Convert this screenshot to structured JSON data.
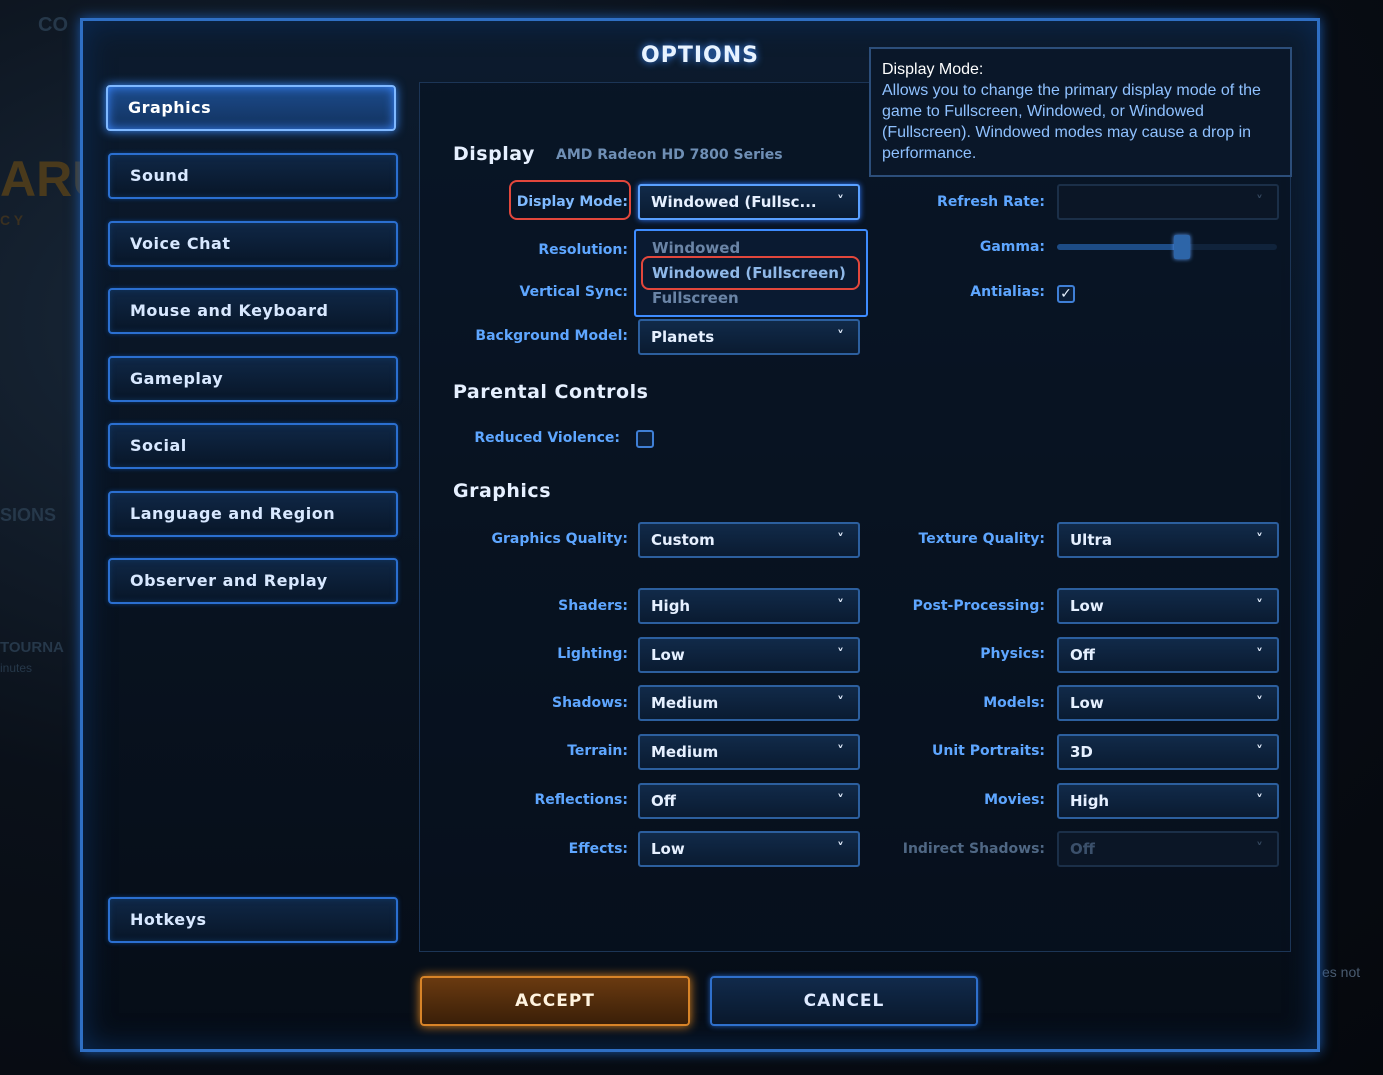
{
  "window": {
    "title": "OPTIONS"
  },
  "nav": [
    {
      "key": "graphics",
      "label": "Graphics",
      "active": true
    },
    {
      "key": "sound",
      "label": "Sound"
    },
    {
      "key": "voice-chat",
      "label": "Voice Chat"
    },
    {
      "key": "mouse-keyboard",
      "label": "Mouse and Keyboard"
    },
    {
      "key": "gameplay",
      "label": "Gameplay"
    },
    {
      "key": "social",
      "label": "Social"
    },
    {
      "key": "language-region",
      "label": "Language and Region"
    },
    {
      "key": "observer-replay",
      "label": "Observer and Replay"
    },
    {
      "key": "hotkeys",
      "label": "Hotkeys"
    }
  ],
  "display": {
    "title": "Display",
    "gpu": "AMD Radeon HD 7800 Series",
    "display_mode_label": "Display Mode:",
    "display_mode_value": "Windowed (Fullsc...",
    "resolution_label": "Resolution:",
    "vsync_label": "Vertical Sync:",
    "background_model_label": "Background Model:",
    "background_model_value": "Planets",
    "refresh_rate_label": "Refresh Rate:",
    "refresh_rate_value": "",
    "gamma_label": "Gamma:",
    "gamma_level": 0.57,
    "antialias_label": "Antialias:",
    "antialias_checked": true,
    "dropdown_options": [
      "Windowed",
      "Windowed (Fullscreen)",
      "Fullscreen"
    ],
    "dropdown_selected": "Windowed (Fullscreen)"
  },
  "parental": {
    "title": "Parental Controls",
    "reduced_violence_label": "Reduced Violence:",
    "reduced_violence_checked": false
  },
  "graphics": {
    "title": "Graphics",
    "quality_label": "Graphics Quality:",
    "quality_value": "Custom",
    "texture_label": "Texture Quality:",
    "texture_value": "Ultra",
    "left": [
      {
        "key": "shaders",
        "label": "Shaders:",
        "value": "High"
      },
      {
        "key": "lighting",
        "label": "Lighting:",
        "value": "Low"
      },
      {
        "key": "shadows",
        "label": "Shadows:",
        "value": "Medium"
      },
      {
        "key": "terrain",
        "label": "Terrain:",
        "value": "Medium"
      },
      {
        "key": "reflections",
        "label": "Reflections:",
        "value": "Off"
      },
      {
        "key": "effects",
        "label": "Effects:",
        "value": "Low"
      }
    ],
    "right": [
      {
        "key": "post-processing",
        "label": "Post-Processing:",
        "value": "Low"
      },
      {
        "key": "physics",
        "label": "Physics:",
        "value": "Off"
      },
      {
        "key": "models",
        "label": "Models:",
        "value": "Low"
      },
      {
        "key": "unit-portraits",
        "label": "Unit Portraits:",
        "value": "3D"
      },
      {
        "key": "movies",
        "label": "Movies:",
        "value": "High"
      },
      {
        "key": "indirect-shadows",
        "label": "Indirect Shadows:",
        "value": "Off",
        "disabled": true
      }
    ]
  },
  "tooltip": {
    "title": "Display Mode:",
    "body": "Allows you to change the primary display mode of the game to Fullscreen, Windowed, or Windowed (Fullscreen).  Windowed modes may cause a drop in performance."
  },
  "buttons": {
    "accept": "ACCEPT",
    "cancel": "CANCEL"
  },
  "background_fragments": {
    "top": "CO",
    "logo": "ARU",
    "cy": "C Y",
    "sions": "SIONS",
    "tourna": "TOURNA",
    "minutes": "inutes",
    "footer": "es not"
  },
  "colors": {
    "accent": "#2f6fc4",
    "highlight": "#e2473c",
    "accept": "#d88428"
  }
}
